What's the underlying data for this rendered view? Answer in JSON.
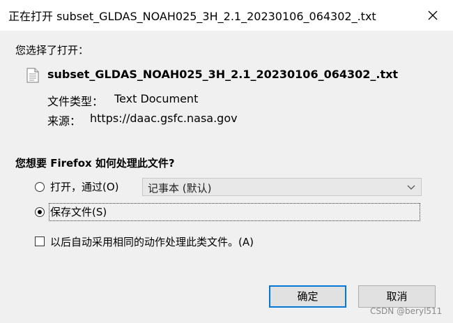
{
  "window": {
    "title": "正在打开 subset_GLDAS_NOAH025_3H_2.1_20230106_064302_.txt",
    "close_icon": "close-icon"
  },
  "prompt": "您选择了打开：",
  "file": {
    "icon": "text-file-icon",
    "name": "subset_GLDAS_NOAH025_3H_2.1_20230106_064302_.txt",
    "type_label": "文件类型：",
    "type_value": "Text Document",
    "source_label": "来源：",
    "source_value": "https://daac.gsfc.nasa.gov"
  },
  "question": "您想要 Firefox 如何处理此文件?",
  "options": {
    "open_label": "打开，通过(O)",
    "open_app": "记事本 (默认)",
    "save_label": "保存文件(S)",
    "selected": "save"
  },
  "remember": {
    "label": "以后自动采用相同的动作处理此类文件。(A)",
    "checked": false
  },
  "buttons": {
    "ok": "确定",
    "cancel": "取消"
  },
  "watermark": "CSDN @beryl511",
  "colors": {
    "accent": "#0078d7",
    "background": "#f0f0f0",
    "titlebar": "#ffffff"
  }
}
